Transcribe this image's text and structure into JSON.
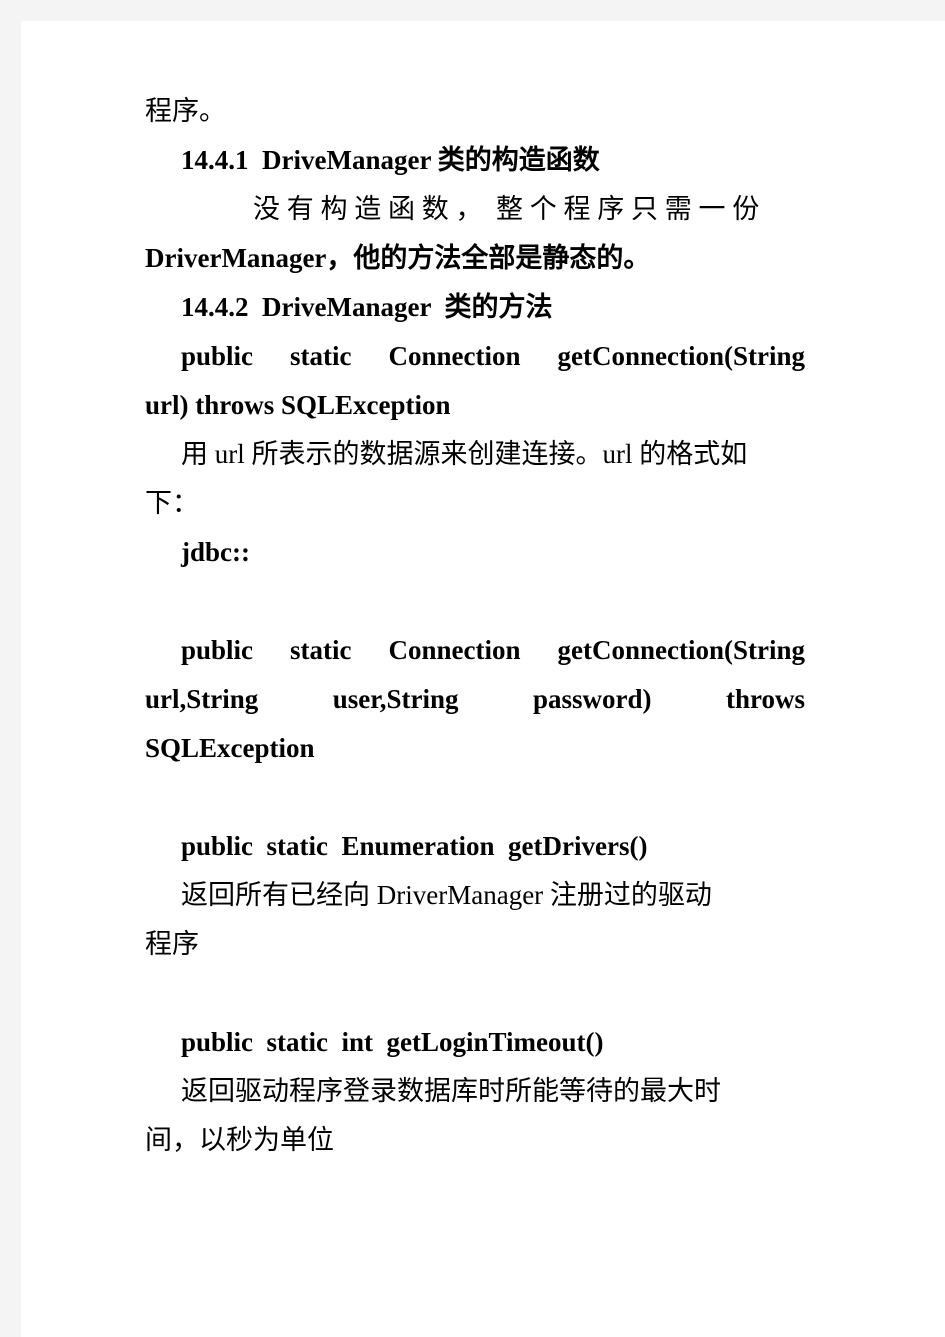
{
  "page": {
    "background_color": "#ffffff",
    "surround_color": "#f4f4f4",
    "text_color": "#000000"
  },
  "document": {
    "blocks": [
      {
        "id": "b1",
        "text": "程序。"
      },
      {
        "id": "b2",
        "text": "14.4.1  DriveManager 类的构造函数"
      },
      {
        "id": "b3a",
        "text": "没 有 构 造 函 数 ，  整 个 程 序 只 需 一 份"
      },
      {
        "id": "b3b",
        "text": "DriverManager，他的方法全部是静态的。"
      },
      {
        "id": "b4",
        "text": "14.4.2  DriveManager  类的方法"
      },
      {
        "id": "b5a_1",
        "text": "public"
      },
      {
        "id": "b5a_2",
        "text": "static"
      },
      {
        "id": "b5a_3",
        "text": "Connection"
      },
      {
        "id": "b5a_4",
        "text": "getConnection(String"
      },
      {
        "id": "b5b",
        "text": "url) throws SQLException"
      },
      {
        "id": "b6a",
        "text": "用 url 所表示的数据源来创建连接。url 的格式如"
      },
      {
        "id": "b6b",
        "text": "下："
      },
      {
        "id": "b7",
        "text": "jdbc::"
      },
      {
        "id": "b8a_1",
        "text": "public"
      },
      {
        "id": "b8a_2",
        "text": "static"
      },
      {
        "id": "b8a_3",
        "text": "Connection"
      },
      {
        "id": "b8a_4",
        "text": "getConnection(String"
      },
      {
        "id": "b8b_1",
        "text": "url,String"
      },
      {
        "id": "b8b_2",
        "text": "user,String"
      },
      {
        "id": "b8b_3",
        "text": "password)"
      },
      {
        "id": "b8b_4",
        "text": "throws"
      },
      {
        "id": "b8c",
        "text": "SQLException"
      },
      {
        "id": "b9",
        "text": "public  static  Enumeration  getDrivers()"
      },
      {
        "id": "b10a",
        "text": "返回所有已经向 DriverManager 注册过的驱动"
      },
      {
        "id": "b10b",
        "text": "程序"
      },
      {
        "id": "b11",
        "text": "public  static  int  getLoginTimeout()"
      },
      {
        "id": "b12a",
        "text": "返回驱动程序登录数据库时所能等待的最大时"
      },
      {
        "id": "b12b",
        "text": "间，以秒为单位"
      }
    ]
  }
}
